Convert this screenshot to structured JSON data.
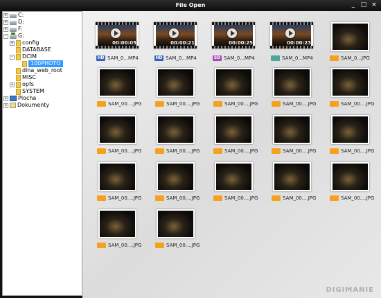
{
  "window": {
    "title": "File Open",
    "controls": [
      "_",
      "□",
      "×"
    ]
  },
  "tree": [
    {
      "label": "C:",
      "expander": "+",
      "icon": "drive-icon",
      "level": 0
    },
    {
      "label": "D:",
      "expander": "+",
      "icon": "drive-icon",
      "level": 0
    },
    {
      "label": "F:",
      "expander": "+",
      "icon": "drive-icon",
      "level": 0
    },
    {
      "label": "G:",
      "expander": "-",
      "icon": "removable-drive-icon",
      "level": 0
    },
    {
      "label": "config",
      "expander": "+",
      "icon": "folder-icon",
      "level": 1
    },
    {
      "label": "DATABASE",
      "expander": "",
      "icon": "folder-icon",
      "level": 1
    },
    {
      "label": "DCIM",
      "expander": "-",
      "icon": "folder-icon",
      "level": 1
    },
    {
      "label": "100PHOTO",
      "expander": "",
      "icon": "folder-icon",
      "level": 2,
      "selected": true
    },
    {
      "label": "dlna_web_root",
      "expander": "",
      "icon": "folder-icon",
      "level": 1
    },
    {
      "label": "MISC",
      "expander": "",
      "icon": "folder-icon",
      "level": 1
    },
    {
      "label": "opfs",
      "expander": "+",
      "icon": "folder-icon",
      "level": 1
    },
    {
      "label": "SYSTEM",
      "expander": "",
      "icon": "folder-icon",
      "level": 1
    },
    {
      "label": "Plocha",
      "expander": "+",
      "icon": "desktop-icon",
      "level": 0
    },
    {
      "label": "Dokumenty",
      "expander": "+",
      "icon": "documents-icon",
      "level": 0
    }
  ],
  "files": [
    {
      "name": "SAM_0...MP4",
      "kind": "video",
      "badge": "HD",
      "duration": "00:00:05"
    },
    {
      "name": "SAM_0...MP4",
      "kind": "video",
      "badge": "HD",
      "duration": "00:00:21"
    },
    {
      "name": "SAM_0...MP4",
      "kind": "video",
      "badge": "SD",
      "duration": "00:00:25"
    },
    {
      "name": "SAM_0...MP4",
      "kind": "video",
      "badge": "",
      "duration": "00:00:23"
    },
    {
      "name": "SAM_0...JPG",
      "kind": "photo"
    },
    {
      "name": "SAM_00....JPG",
      "kind": "photo"
    },
    {
      "name": "SAM_00....JPG",
      "kind": "photo"
    },
    {
      "name": "SAM_00....JPG",
      "kind": "photo"
    },
    {
      "name": "SAM_00....JPG",
      "kind": "photo"
    },
    {
      "name": "SAM_00....JPG",
      "kind": "photo"
    },
    {
      "name": "SAM_00....JPG",
      "kind": "photo"
    },
    {
      "name": "SAM_00....JPG",
      "kind": "photo"
    },
    {
      "name": "SAM_00....JPG",
      "kind": "photo"
    },
    {
      "name": "SAM_00....JPG",
      "kind": "photo"
    },
    {
      "name": "SAM_00....JPG",
      "kind": "photo"
    },
    {
      "name": "SAM_00....JPG",
      "kind": "photo"
    },
    {
      "name": "SAM_00....JPG",
      "kind": "photo"
    },
    {
      "name": "SAM_00....JPG",
      "kind": "photo"
    },
    {
      "name": "SAM_00....JPG",
      "kind": "photo"
    },
    {
      "name": "SAM_00....JPG",
      "kind": "photo"
    },
    {
      "name": "SAM_00....JPG",
      "kind": "photo"
    },
    {
      "name": "SAM_00....JPG",
      "kind": "photo"
    }
  ],
  "watermark": "DIGIMANIE"
}
